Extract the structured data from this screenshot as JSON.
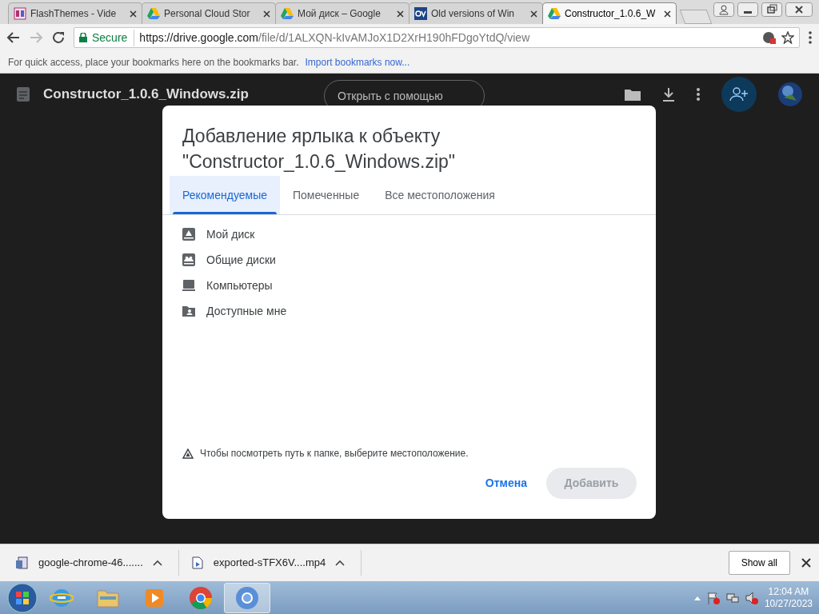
{
  "browser_tabs": [
    {
      "title": "FlashThemes - Vide",
      "kind": "ft",
      "selected": false
    },
    {
      "title": "Personal Cloud Stor",
      "kind": "drive",
      "selected": false
    },
    {
      "title": "Мой диск – Google",
      "kind": "drive",
      "selected": false
    },
    {
      "title": "Old versions of Win",
      "kind": "ov",
      "selected": false
    },
    {
      "title": "Constructor_1.0.6_W",
      "kind": "drive",
      "selected": true
    }
  ],
  "address_bar": {
    "secure_label": "Secure",
    "url_host": "https://drive.google.com",
    "url_path": "/file/d/1ALXQN-kIvAMJoX1D2XrH190hFDgoYtdQ/view"
  },
  "bookmarks_bar": {
    "text": "For quick access, place your bookmarks here on the bookmarks bar.",
    "link": "Import bookmarks now..."
  },
  "viewer": {
    "file_name": "Constructor_1.0.6_Windows.zip",
    "open_with": "Открыть с помощью"
  },
  "dialog": {
    "title": "Добавление ярлыка к объекту \"Constructor_1.0.6_Windows.zip\"",
    "tabs": [
      {
        "label": "Рекомендуемые",
        "selected": true
      },
      {
        "label": "Помеченные",
        "selected": false
      },
      {
        "label": "Все местоположения",
        "selected": false
      }
    ],
    "items": [
      {
        "label": "Мой диск",
        "kind": "drive"
      },
      {
        "label": "Общие диски",
        "kind": "shared"
      },
      {
        "label": "Компьютеры",
        "kind": "computer"
      },
      {
        "label": "Доступные мне",
        "kind": "shared_with_me"
      }
    ],
    "hint": "Чтобы посмотреть путь к папке, выберите местоположение.",
    "cancel": "Отмена",
    "add": {
      "label": "Добавить",
      "disabled": true
    }
  },
  "downloads": [
    {
      "name": "google-chrome-46.......",
      "kind": "installer"
    },
    {
      "name": "exported-sTFX6V....mp4",
      "kind": "video"
    }
  ],
  "show_all": "Show all",
  "taskbar": {
    "apps": [
      {
        "kind": "ie",
        "active": false
      },
      {
        "kind": "explorer",
        "active": false
      },
      {
        "kind": "media",
        "active": false
      },
      {
        "kind": "chrome",
        "active": false
      },
      {
        "kind": "chromium",
        "active": true
      }
    ],
    "time": "12:04 AM",
    "date": "10/27/2023"
  }
}
